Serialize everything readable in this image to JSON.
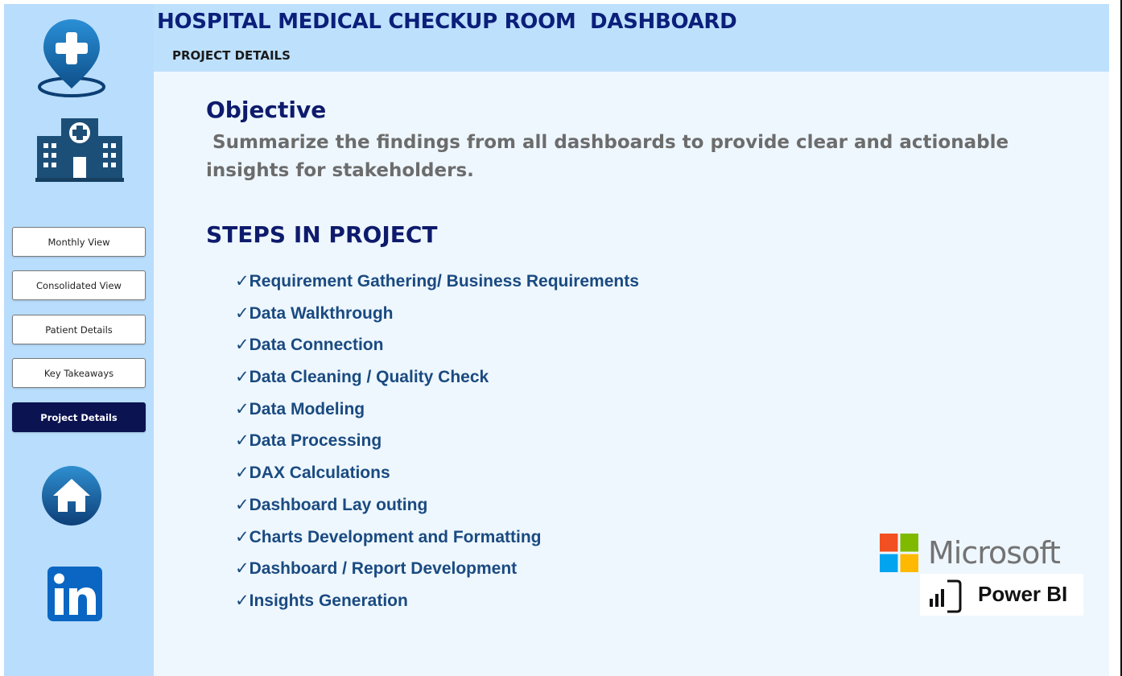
{
  "header": {
    "title": "HOSPITAL MEDICAL CHECKUP ROOM  DASHBOARD",
    "subtitle": "PROJECT DETAILS"
  },
  "sidebar": {
    "nav": [
      {
        "label": "Monthly View",
        "active": false
      },
      {
        "label": "Consolidated View",
        "active": false
      },
      {
        "label": "Patient Details",
        "active": false
      },
      {
        "label": "Key Takeaways",
        "active": false
      },
      {
        "label": "Project Details",
        "active": true
      }
    ],
    "icons": [
      "location-pin-cross-icon",
      "hospital-building-icon",
      "home-icon",
      "linkedin-icon"
    ]
  },
  "main": {
    "objective": {
      "heading": "Objective",
      "text": " Summarize the findings from all dashboards to provide clear and actionable insights for stakeholders."
    },
    "steps": {
      "heading": "STEPS IN PROJECT",
      "check_mark": "✓",
      "items": [
        "Requirement Gathering/ Business Requirements",
        "Data Walkthrough",
        "Data Connection",
        "Data Cleaning / Quality Check",
        "Data Modeling",
        "Data Processing",
        "DAX Calculations",
        "Dashboard Lay outing",
        "Charts Development and Formatting",
        "Dashboard / Report Development",
        "Insights Generation"
      ]
    },
    "logos": {
      "microsoft": "Microsoft",
      "powerbi": "Power BI"
    }
  },
  "colors": {
    "sidebar_bg": "#b9ddfc",
    "header_bg": "#bde0fd",
    "main_bg": "#eef7fe",
    "title": "#0b1f7a",
    "active_button": "#0b1450",
    "step_text": "#1a4a80",
    "objective_text": "#6c6c6c"
  }
}
